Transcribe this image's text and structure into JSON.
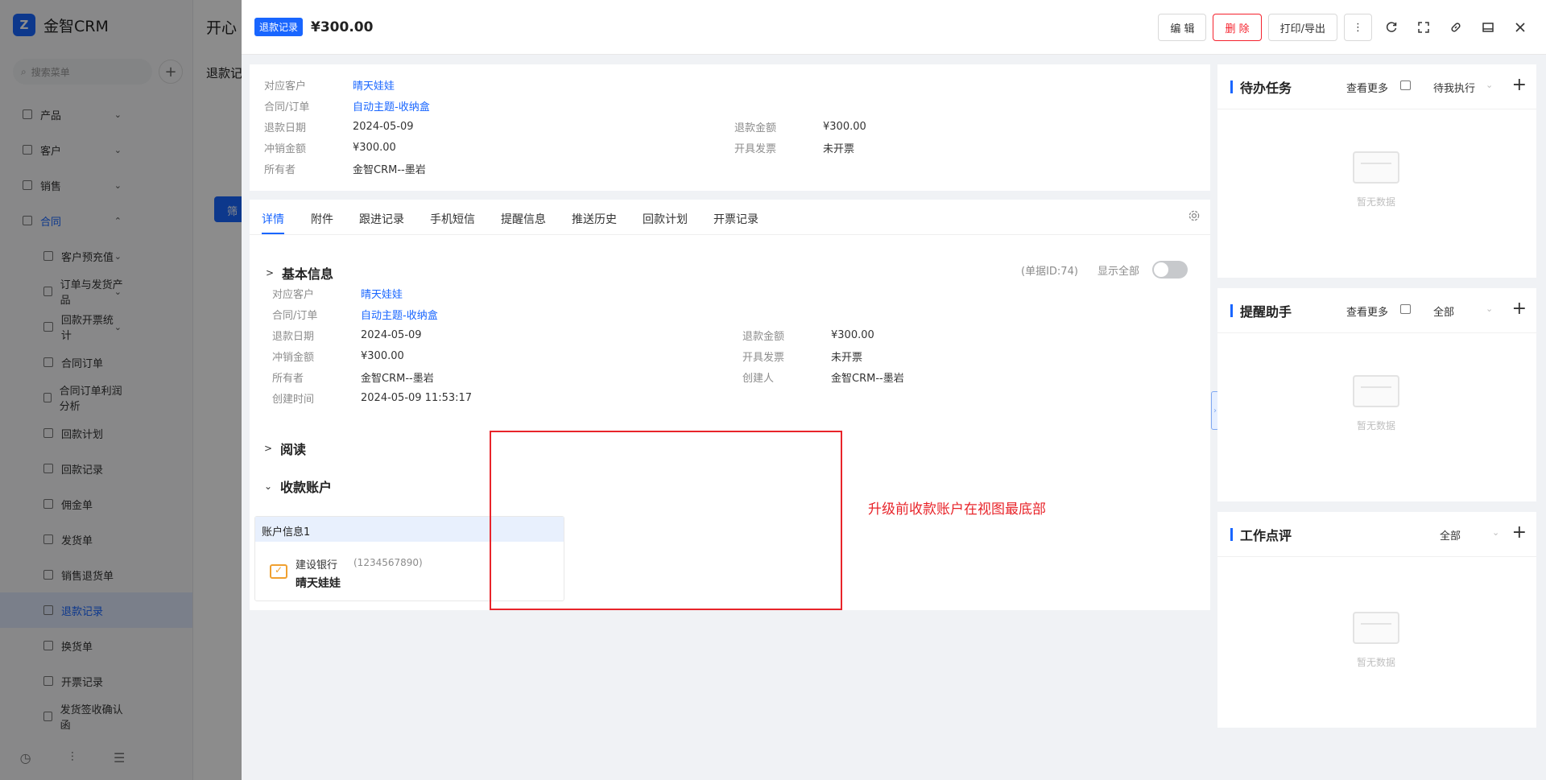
{
  "app": {
    "brand": "金智CRM",
    "search_placeholder": "搜索菜单",
    "bg_title": "开心",
    "bg_subtitle": "退款记",
    "bg_filter_button": "筛"
  },
  "sidebar": {
    "items": [
      {
        "label": "产品"
      },
      {
        "label": "客户"
      },
      {
        "label": "销售"
      },
      {
        "label": "合同"
      },
      {
        "label": "客户预充值"
      },
      {
        "label": "订单与发货产品"
      },
      {
        "label": "回款开票统计"
      },
      {
        "label": "合同订单"
      },
      {
        "label": "合同订单利润分析"
      },
      {
        "label": "回款计划"
      },
      {
        "label": "回款记录"
      },
      {
        "label": "佣金单"
      },
      {
        "label": "发货单"
      },
      {
        "label": "销售退货单"
      },
      {
        "label": "退款记录"
      },
      {
        "label": "换货单"
      },
      {
        "label": "开票记录"
      },
      {
        "label": "发货签收确认函"
      }
    ]
  },
  "drawer": {
    "tag": "退款记录",
    "title_amount": "¥300.00",
    "actions": {
      "edit": "编 辑",
      "delete": "删 除",
      "print": "打印/导出"
    },
    "summary": {
      "customer_label": "对应客户",
      "customer_value": "晴天娃娃",
      "contract_label": "合同/订单",
      "contract_value": "自动主题-收纳盒",
      "date_label": "退款日期",
      "date_value": "2024-05-09",
      "amount_label": "退款金额",
      "amount_value": "¥300.00",
      "offset_label": "冲销金额",
      "offset_value": "¥300.00",
      "invoice_label": "开具发票",
      "invoice_value": "未开票",
      "owner_label": "所有者",
      "owner_value": "金智CRM--墨岩"
    },
    "tabs": [
      "详情",
      "附件",
      "跟进记录",
      "手机短信",
      "提醒信息",
      "推送历史",
      "回款计划",
      "开票记录"
    ],
    "basic": {
      "title": "基本信息",
      "doc_id": "(单据ID:74)",
      "show_all": "显示全部",
      "customer_label": "对应客户",
      "customer_value": "晴天娃娃",
      "contract_label": "合同/订单",
      "contract_value": "自动主题-收纳盒",
      "date_label": "退款日期",
      "date_value": "2024-05-09",
      "amount_label": "退款金额",
      "amount_value": "¥300.00",
      "offset_label": "冲销金额",
      "offset_value": "¥300.00",
      "invoice_label": "开具发票",
      "invoice_value": "未开票",
      "owner_label": "所有者",
      "owner_value": "金智CRM--墨岩",
      "creator_label": "创建人",
      "creator_value": "金智CRM--墨岩",
      "created_label": "创建时间",
      "created_value": "2024-05-09 11:53:17"
    },
    "read_section": "阅读",
    "account_section": "收款账户",
    "account": {
      "title": "账户信息1",
      "bank": "建设银行",
      "number": "(1234567890)",
      "name": "晴天娃娃"
    },
    "annotation": "升级前收款账户在视图最底部"
  },
  "widgets": {
    "todo": {
      "title": "待办任务",
      "more": "查看更多",
      "filter": "待我执行",
      "empty": "暂无数据"
    },
    "reminder": {
      "title": "提醒助手",
      "more": "查看更多",
      "filter": "全部",
      "empty": "暂无数据"
    },
    "review": {
      "title": "工作点评",
      "filter": "全部",
      "empty": "暂无数据"
    }
  }
}
